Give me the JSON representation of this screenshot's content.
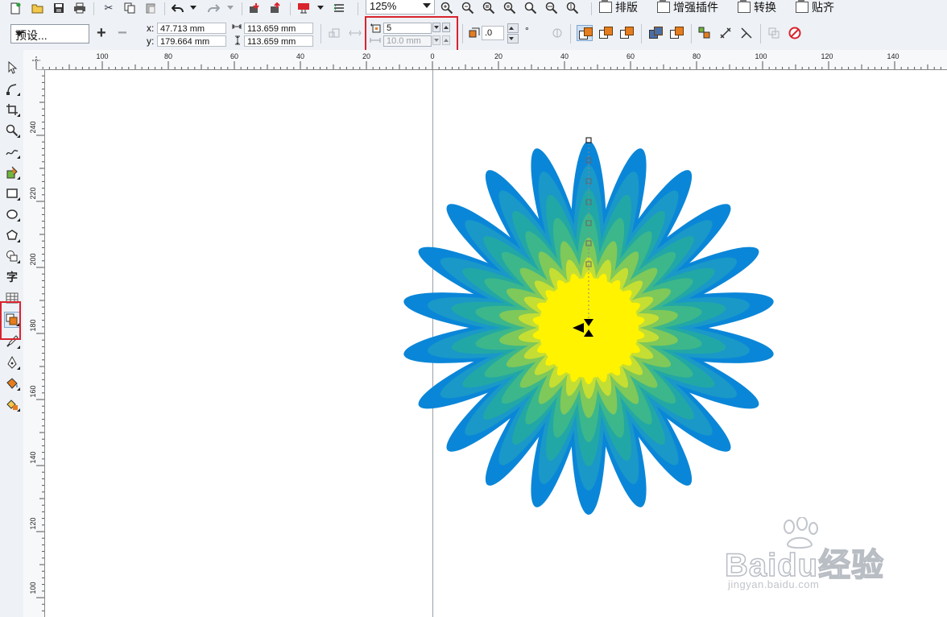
{
  "toolbar": {
    "zoom_value": "125%",
    "menus": [
      {
        "label": "排版"
      },
      {
        "label": "增强插件"
      },
      {
        "label": "转换"
      },
      {
        "label": "贴齐"
      }
    ]
  },
  "property_bar": {
    "preset_label": "预设...",
    "x_label": "x:",
    "y_label": "y:",
    "x_value": "47.713 mm",
    "y_value": "179.664 mm",
    "width_value": "113.659 mm",
    "height_value": "113.659 mm",
    "steps_value": "5",
    "offset_value": "10.0 mm",
    "angle_value": ".0",
    "degree_symbol": "°"
  },
  "left_tools": {
    "text_tool_label": "字"
  },
  "rulers": {
    "horizontal": [
      "100",
      "80",
      "60",
      "40",
      "20",
      "0",
      "20",
      "40",
      "60",
      "80",
      "100",
      "120",
      "140"
    ],
    "vertical": [
      "240",
      "220",
      "200",
      "180",
      "160",
      "140",
      "120",
      "100"
    ]
  },
  "watermark": {
    "main": "Baidu经验",
    "sub": "jingyan.baidu.com"
  },
  "colors": {
    "highlight": "#d9232d",
    "petal_outer": "#0a86d8",
    "center": "#fff300"
  }
}
